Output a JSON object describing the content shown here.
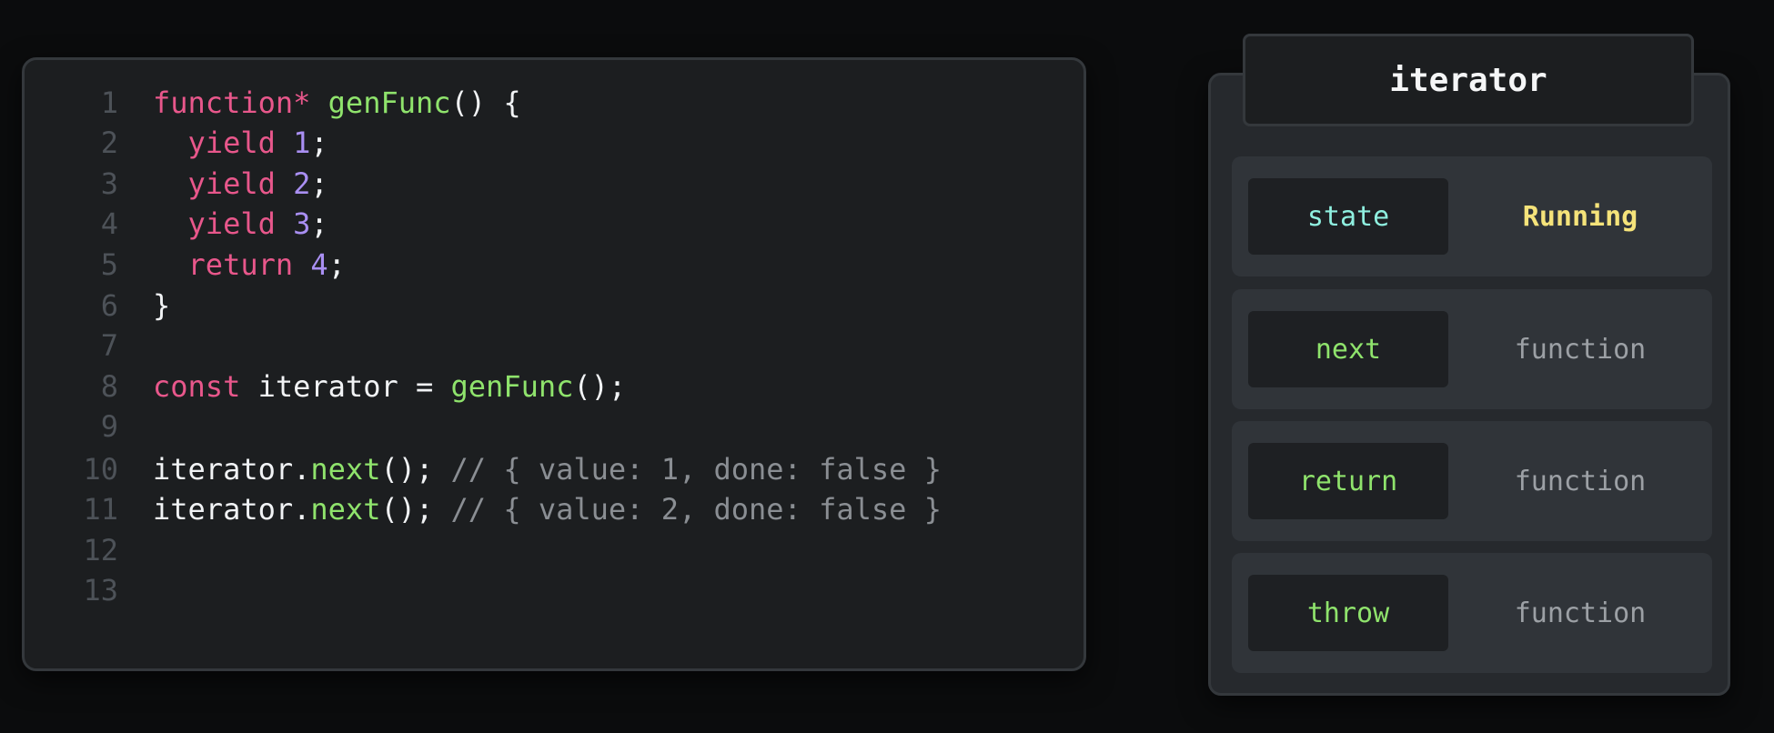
{
  "code": {
    "lines": [
      {
        "n": "1",
        "tokens": [
          [
            "kw",
            "function*"
          ],
          [
            "pl",
            " "
          ],
          [
            "fn",
            "genFunc"
          ],
          [
            "pl",
            "() {"
          ]
        ]
      },
      {
        "n": "2",
        "tokens": [
          [
            "pl",
            "  "
          ],
          [
            "kw",
            "yield"
          ],
          [
            "pl",
            " "
          ],
          [
            "num",
            "1"
          ],
          [
            "pl",
            ";"
          ]
        ]
      },
      {
        "n": "3",
        "tokens": [
          [
            "pl",
            "  "
          ],
          [
            "kw",
            "yield"
          ],
          [
            "pl",
            " "
          ],
          [
            "num",
            "2"
          ],
          [
            "pl",
            ";"
          ]
        ]
      },
      {
        "n": "4",
        "tokens": [
          [
            "pl",
            "  "
          ],
          [
            "kw",
            "yield"
          ],
          [
            "pl",
            " "
          ],
          [
            "num",
            "3"
          ],
          [
            "pl",
            ";"
          ]
        ]
      },
      {
        "n": "5",
        "tokens": [
          [
            "pl",
            "  "
          ],
          [
            "kw",
            "return"
          ],
          [
            "pl",
            " "
          ],
          [
            "num",
            "4"
          ],
          [
            "pl",
            ";"
          ]
        ]
      },
      {
        "n": "6",
        "tokens": [
          [
            "pl",
            "}"
          ]
        ]
      },
      {
        "n": "7",
        "tokens": []
      },
      {
        "n": "8",
        "tokens": [
          [
            "kw",
            "const"
          ],
          [
            "pl",
            " iterator = "
          ],
          [
            "fn",
            "genFunc"
          ],
          [
            "pl",
            "();"
          ]
        ]
      },
      {
        "n": "9",
        "tokens": []
      },
      {
        "n": "10",
        "tokens": [
          [
            "pl",
            "iterator."
          ],
          [
            "fn",
            "next"
          ],
          [
            "pl",
            "(); "
          ],
          [
            "cm",
            "// { value: 1, done: false }"
          ]
        ]
      },
      {
        "n": "11",
        "tokens": [
          [
            "pl",
            "iterator."
          ],
          [
            "fn",
            "next"
          ],
          [
            "pl",
            "(); "
          ],
          [
            "cm",
            "// { value: 2, done: false }"
          ]
        ]
      },
      {
        "n": "12",
        "tokens": []
      },
      {
        "n": "13",
        "tokens": []
      }
    ]
  },
  "iterator_panel": {
    "title": "iterator",
    "properties": [
      {
        "key": "state",
        "value": "Running"
      },
      {
        "key": "next",
        "value": "function"
      },
      {
        "key": "return",
        "value": "function"
      },
      {
        "key": "throw",
        "value": "function"
      }
    ]
  },
  "colors": {
    "keyword": "#e8578b",
    "function_name": "#8fe36c",
    "number": "#a98ff2",
    "comment": "#8a8e93",
    "state_key": "#8ff0e0",
    "state_value": "#f5e37a"
  }
}
